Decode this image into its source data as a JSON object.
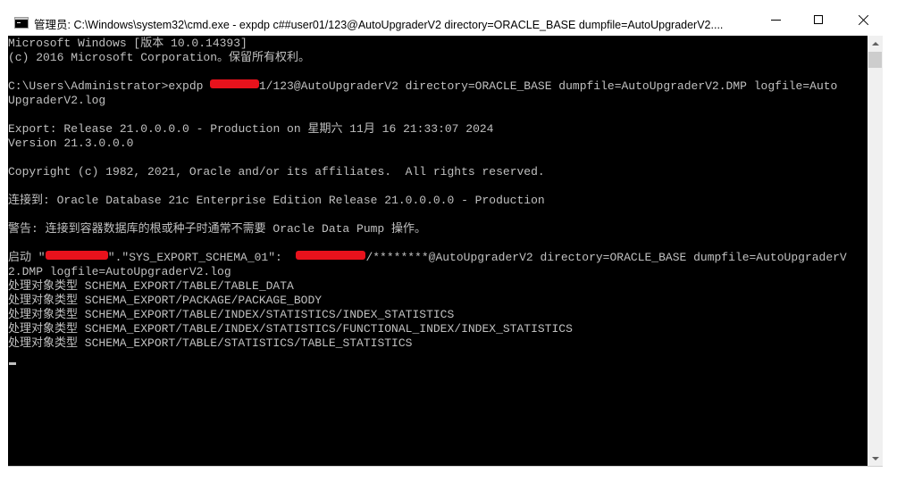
{
  "window": {
    "title": "管理员: C:\\Windows\\system32\\cmd.exe - expdp  c##user01/123@AutoUpgraderV2 directory=ORACLE_BASE dumpfile=AutoUpgraderV2....",
    "icon": "cmd-icon",
    "controls": {
      "minimize": "minimize-icon",
      "maximize": "maximize-icon",
      "close": "close-icon"
    }
  },
  "console": {
    "colors": {
      "background": "#000000",
      "text": "#c0c0c0",
      "redaction": "#e8121c"
    },
    "lines": [
      {
        "segments": [
          {
            "text": "Microsoft Windows [版本 10.0.14393]"
          }
        ]
      },
      {
        "segments": [
          {
            "text": "(c) 2016 Microsoft Corporation。保留所有权利。"
          }
        ]
      },
      {
        "segments": [
          {
            "text": ""
          }
        ]
      },
      {
        "segments": [
          {
            "text": "C:\\Users\\Administrator>expdp "
          },
          {
            "redact": 7
          },
          {
            "text": "1/123@AutoUpgraderV2 directory=ORACLE_BASE dumpfile=AutoUpgraderV2.DMP logfile=Auto"
          }
        ]
      },
      {
        "segments": [
          {
            "text": "UpgraderV2.log"
          }
        ]
      },
      {
        "segments": [
          {
            "text": ""
          }
        ]
      },
      {
        "segments": [
          {
            "text": "Export: Release 21.0.0.0.0 - Production on 星期六 11月 16 21:33:07 2024"
          }
        ]
      },
      {
        "segments": [
          {
            "text": "Version 21.3.0.0.0"
          }
        ]
      },
      {
        "segments": [
          {
            "text": ""
          }
        ]
      },
      {
        "segments": [
          {
            "text": "Copyright (c) 1982, 2021, Oracle and/or its affiliates.  All rights reserved."
          }
        ]
      },
      {
        "segments": [
          {
            "text": ""
          }
        ]
      },
      {
        "segments": [
          {
            "text": "连接到: Oracle Database 21c Enterprise Edition Release 21.0.0.0.0 - Production"
          }
        ]
      },
      {
        "segments": [
          {
            "text": ""
          }
        ]
      },
      {
        "segments": [
          {
            "text": "警告: 连接到容器数据库的根或种子时通常不需要 Oracle Data Pump 操作。"
          }
        ]
      },
      {
        "segments": [
          {
            "text": ""
          }
        ]
      },
      {
        "segments": [
          {
            "text": "启动 \""
          },
          {
            "redact": 9
          },
          {
            "text": "\".\"SYS_EXPORT_SCHEMA_01\":  "
          },
          {
            "redact": 10
          },
          {
            "text": "/********@AutoUpgraderV2 directory=ORACLE_BASE dumpfile=AutoUpgraderV"
          }
        ]
      },
      {
        "segments": [
          {
            "text": "2.DMP logfile=AutoUpgraderV2.log"
          }
        ]
      },
      {
        "segments": [
          {
            "text": "处理对象类型 SCHEMA_EXPORT/TABLE/TABLE_DATA"
          }
        ]
      },
      {
        "segments": [
          {
            "text": "处理对象类型 SCHEMA_EXPORT/PACKAGE/PACKAGE_BODY"
          }
        ]
      },
      {
        "segments": [
          {
            "text": "处理对象类型 SCHEMA_EXPORT/TABLE/INDEX/STATISTICS/INDEX_STATISTICS"
          }
        ]
      },
      {
        "segments": [
          {
            "text": "处理对象类型 SCHEMA_EXPORT/TABLE/INDEX/STATISTICS/FUNCTIONAL_INDEX/INDEX_STATISTICS"
          }
        ]
      },
      {
        "segments": [
          {
            "text": "处理对象类型 SCHEMA_EXPORT/TABLE/STATISTICS/TABLE_STATISTICS"
          }
        ]
      }
    ]
  },
  "scrollbar": {
    "up_icon": "scroll-up-arrow-icon",
    "down_icon": "scroll-down-arrow-icon"
  }
}
